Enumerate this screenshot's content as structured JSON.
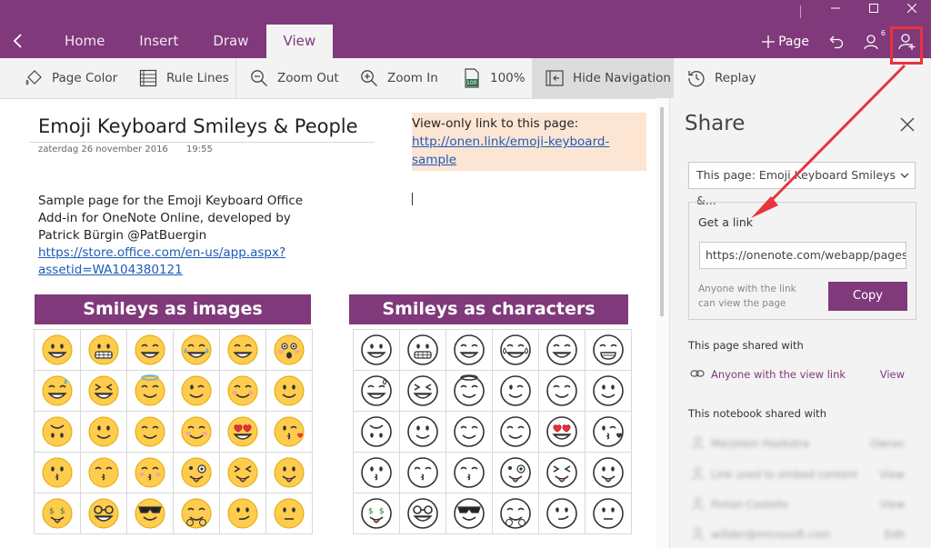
{
  "titlebar": {
    "tabs": [
      {
        "label": "Home",
        "active": false
      },
      {
        "label": "Insert",
        "active": false
      },
      {
        "label": "Draw",
        "active": false
      },
      {
        "label": "View",
        "active": true
      }
    ],
    "page_label": "Page",
    "user_count": "6",
    "accent_color": "#80397b"
  },
  "ribbon": {
    "page_color": "Page Color",
    "rule_lines": "Rule Lines",
    "zoom_out": "Zoom Out",
    "zoom_in": "Zoom In",
    "zoom_level": "100%",
    "zoom_badge": "100",
    "hide_navigation": "Hide Navigation",
    "replay": "Replay"
  },
  "page": {
    "title": "Emoji Keyboard Smileys & People",
    "date": "zaterdag 26 november 2016",
    "time": "19:55",
    "note_label": "View-only link to this page:",
    "note_link": "http://onen.link/emoji-keyboard-sample",
    "intro_lines": [
      "Sample page for the Emoji Keyboard Office",
      "Add-in for OneNote Online, developed by",
      "Patrick Bürgin @PatBuergin"
    ],
    "store_link_1": "https://store.office.com/en-us/app.aspx?",
    "store_link_2": "assetid=WA104380121",
    "banner_images": "Smileys as images",
    "banner_chars": "Smileys as characters"
  },
  "share": {
    "title": "Share",
    "select_value": "This page: Emoji Keyboard Smileys &...",
    "get_link_title": "Get a link",
    "link_value": "https://onenote.com/webapp/pages?",
    "link_note": "Anyone with the link can view the page",
    "copy_label": "Copy",
    "page_shared_with": "This page shared with",
    "anyone_view_link": "Anyone with the view link",
    "view_label": "View",
    "notebook_shared_with": "This notebook shared with",
    "people": [
      {
        "name": "Marjolein Hoekstra",
        "role": "Owner"
      },
      {
        "name": "Link used to embed content",
        "role": "View"
      },
      {
        "name": "Fintan Costello",
        "role": "View"
      },
      {
        "name": "willder@microsoft.com",
        "role": "Edit"
      }
    ]
  },
  "icons": [
    "back-arrow-icon",
    "plus-icon",
    "undo-icon",
    "people-icon",
    "add-person-icon",
    "page-color-icon",
    "rule-lines-icon",
    "zoom-out-icon",
    "zoom-in-icon",
    "page-zoom-icon",
    "hide-navigation-icon",
    "replay-icon",
    "close-icon",
    "chevron-down-icon",
    "link-icon",
    "person-icon"
  ],
  "emoji_images": [
    [
      "grin",
      "grimace",
      "grin-big",
      "joy",
      "grin-closed",
      "astonished"
    ],
    [
      "sweat-smile",
      "laughing",
      "halo",
      "wink",
      "blush",
      "smile"
    ],
    [
      "upside-down",
      "slight-smile",
      "relieved-smile",
      "relieved",
      "heart-eyes",
      "kiss-heart"
    ],
    [
      "kissing",
      "kiss-smile",
      "kiss-blush",
      "crazy",
      "squint-tongue",
      "tongue"
    ],
    [
      "money",
      "nerd",
      "cool",
      "hug",
      "smirk",
      "flat"
    ]
  ],
  "emoji_chars": [
    [
      "grin",
      "grimace",
      "grin-big",
      "joy",
      "grin-closed",
      "grin-tight"
    ],
    [
      "sweat-smile",
      "laughing",
      "halo",
      "wink",
      "relieved",
      "smile"
    ],
    [
      "upside-down",
      "slight-smile",
      "relieved-smile",
      "relieved",
      "heart-eyes",
      "kiss-heart"
    ],
    [
      "kissing",
      "kiss-smile",
      "kiss-blush",
      "crazy",
      "squint-tongue",
      "tongue"
    ],
    [
      "money",
      "nerd",
      "cool",
      "hug",
      "smirk",
      "flat"
    ]
  ]
}
